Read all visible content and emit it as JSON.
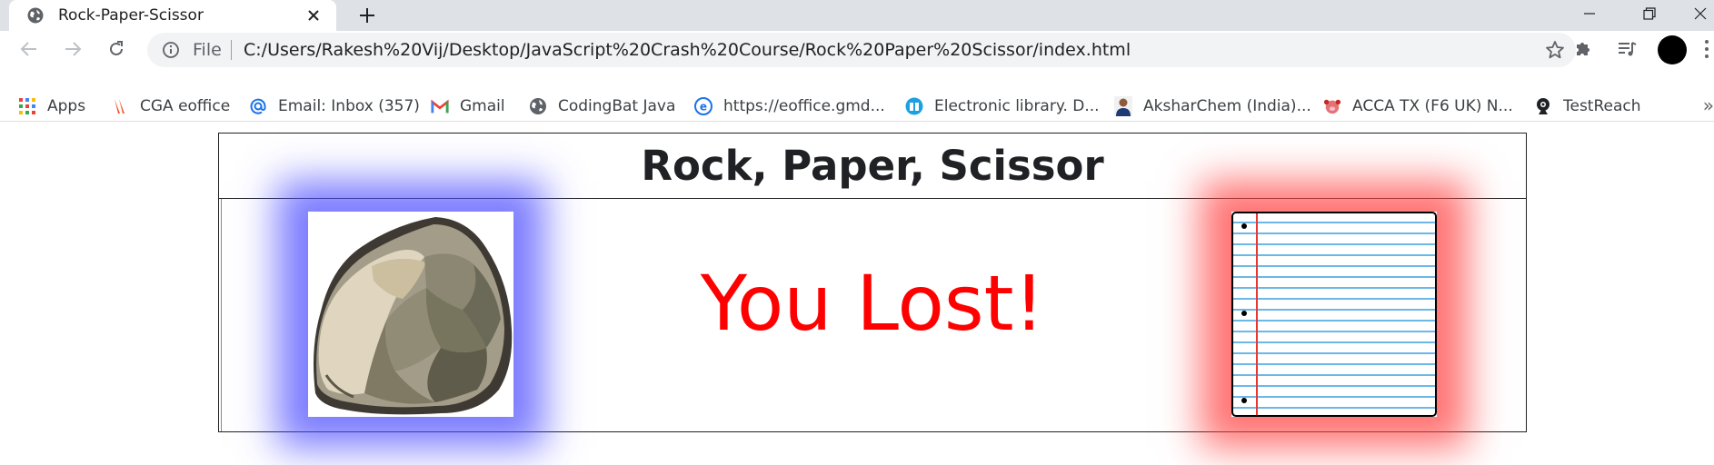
{
  "browser": {
    "tab": {
      "title": "Rock-Paper-Scissor"
    },
    "address_bar": {
      "scheme_label": "File",
      "url": "C:/Users/Rakesh%20Vij/Desktop/JavaScript%20Crash%20Course/Rock%20Paper%20Scissor/index.html"
    },
    "bookmarks": [
      {
        "label": "Apps",
        "icon": "apps-grid-icon"
      },
      {
        "label": "CGA eoffice",
        "icon": "cga-icon"
      },
      {
        "label": "Email: Inbox (357)",
        "icon": "at-sign-icon"
      },
      {
        "label": "Gmail",
        "icon": "gmail-icon"
      },
      {
        "label": "CodingBat Java",
        "icon": "globe-icon"
      },
      {
        "label": "https://eoffice.gmd...",
        "icon": "eoffice-icon"
      },
      {
        "label": "Electronic library. D...",
        "icon": "book-icon"
      },
      {
        "label": "AksharChem (India)...",
        "icon": "person-icon"
      },
      {
        "label": "ACCA TX (F6 UK) N...",
        "icon": "pig-icon"
      },
      {
        "label": "TestReach",
        "icon": "webcam-icon"
      }
    ],
    "more_label": "»"
  },
  "game": {
    "title": "Rock, Paper, Scissor",
    "result": "You Lost!",
    "player_choice": "rock",
    "computer_choice": "paper"
  },
  "colors": {
    "result": "#ff0000",
    "player_glow": "#5050ff",
    "computer_glow": "#ff4646"
  }
}
